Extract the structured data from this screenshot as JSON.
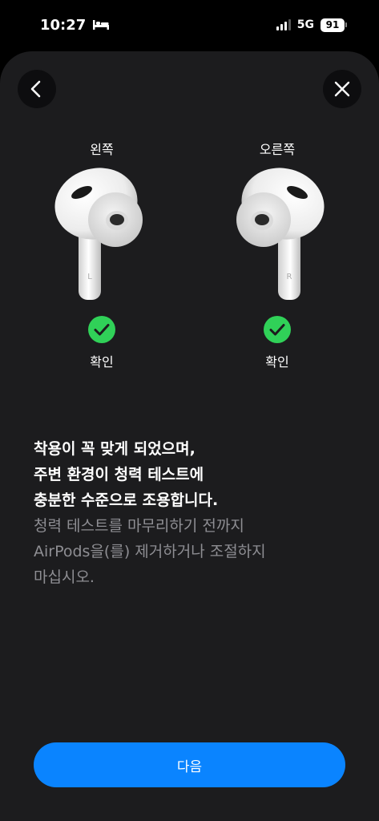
{
  "status_bar": {
    "time": "10:27",
    "network": "5G",
    "battery": "91",
    "icons": [
      "bed-icon",
      "signal-icon",
      "battery-icon"
    ]
  },
  "nav": {
    "back_icon": "chevron-left-icon",
    "close_icon": "close-icon"
  },
  "earbuds": {
    "left": {
      "side_label": "왼쪽",
      "stem_letter": "L",
      "status": "확인",
      "status_icon": "checkmark-circle-icon"
    },
    "right": {
      "side_label": "오른쪽",
      "stem_letter": "R",
      "status": "확인",
      "status_icon": "checkmark-circle-icon"
    }
  },
  "message": {
    "headline_lines": [
      "착용이 꼭 맞게 되었으며,",
      "주변 환경이 청력 테스트에",
      "충분한 수준으로 조용합니다."
    ],
    "sub_lines": [
      "청력 테스트를 마무리하기 전까지",
      "AirPods을(를) 제거하거나 조절하지",
      "마십시오."
    ]
  },
  "footer": {
    "next_label": "다음"
  },
  "colors": {
    "accent": "#0a84ff",
    "success": "#30d158",
    "sheet": "#1c1c1e",
    "secondary_text": "#8e8e93"
  }
}
